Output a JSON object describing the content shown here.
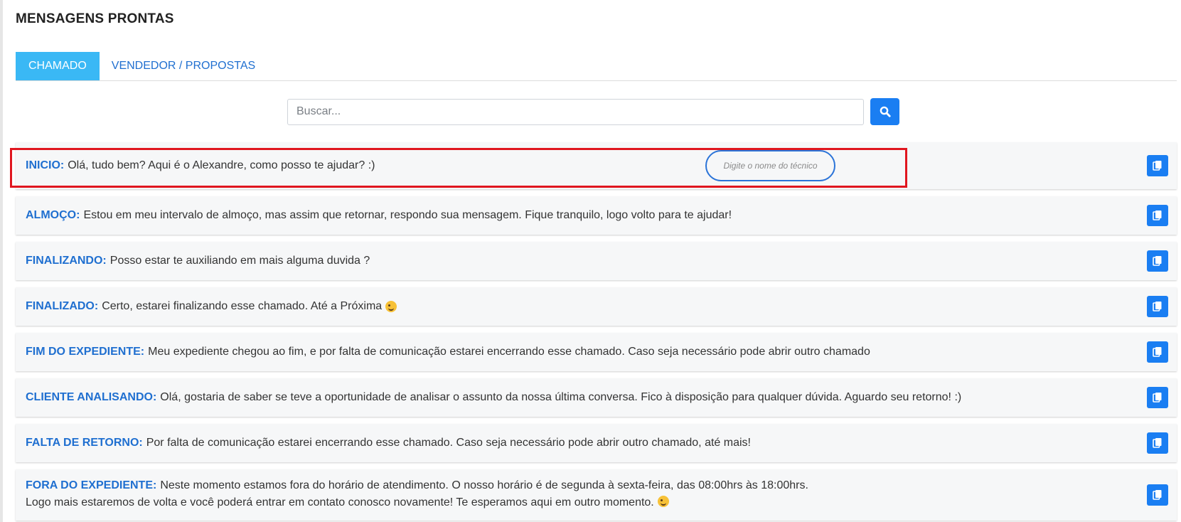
{
  "page": {
    "title": "MENSAGENS PRONTAS"
  },
  "tabs": [
    {
      "label": "CHAMADO",
      "active": true
    },
    {
      "label": "VENDEDOR / PROPOSTAS",
      "active": false
    }
  ],
  "search": {
    "placeholder": "Buscar...",
    "value": "",
    "button_icon": "search-icon"
  },
  "tech_input": {
    "placeholder": "Digite o nome do técnico",
    "value": ""
  },
  "messages": [
    {
      "label": "INICIO:",
      "text": "Olá, tudo bem? Aqui é o Alexandre, como posso te ajudar? :)",
      "highlighted": true
    },
    {
      "label": "ALMOÇO:",
      "text": "Estou em meu intervalo de almoço, mas assim que retornar, respondo sua mensagem. Fique tranquilo, logo volto para te ajudar!"
    },
    {
      "label": "FINALIZANDO:",
      "text": "Posso estar te auxiliando em mais alguma duvida ?"
    },
    {
      "label": "FINALIZADO:",
      "text": "Certo, estarei finalizando esse chamado. Até a Próxima",
      "emoji": "wink-emoji"
    },
    {
      "label": "FIM DO EXPEDIENTE:",
      "text": "Meu expediente chegou ao fim, e por falta de comunicação estarei encerrando esse chamado. Caso seja necessário pode abrir outro chamado"
    },
    {
      "label": "CLIENTE ANALISANDO:",
      "text": "Olá, gostaria de saber se teve a oportunidade de analisar o assunto da nossa última conversa. Fico à disposição para qualquer dúvida. Aguardo seu retorno! :)"
    },
    {
      "label": "FALTA DE RETORNO:",
      "text": "Por falta de comunicação estarei encerrando esse chamado. Caso seja necessário pode abrir outro chamado, até mais!"
    },
    {
      "label": "FORA DO EXPEDIENTE:",
      "text": "Neste momento estamos fora do horário de atendimento. O nosso horário é de segunda à sexta-feira, das 08:00hrs às 18:00hrs.\nLogo mais estaremos de volta e você poderá entrar em contato conosco novamente! Te esperamos aqui em outro momento.",
      "emoji": "wink-emoji"
    }
  ],
  "colors": {
    "accent": "#1a7ef2",
    "active_tab": "#3ab8f5",
    "label": "#1f6fd0",
    "highlight_border": "#e0161f"
  },
  "icons": {
    "copy": "copy-icon",
    "search": "search-icon"
  }
}
